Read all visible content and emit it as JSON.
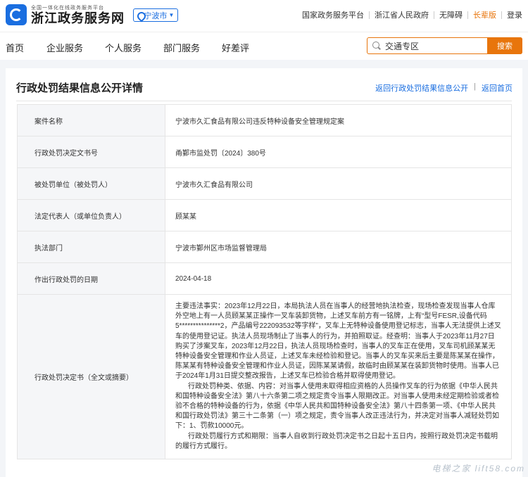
{
  "header": {
    "logo_sub": "全国一体化在线政务服务平台",
    "logo_main": "浙江政务服务网",
    "city": "宁波市",
    "links": [
      "国家政务服务平台",
      "浙江省人民政府",
      "无障碍",
      "长辈版",
      "登录"
    ]
  },
  "nav": {
    "items": [
      "首页",
      "企业服务",
      "个人服务",
      "部门服务",
      "好差评"
    ]
  },
  "search": {
    "value": "交通专区",
    "button": "搜索"
  },
  "page": {
    "title": "行政处罚结果信息公开详情",
    "link_back_list": "返回行政处罚结果信息公开",
    "link_sep": "|",
    "link_home": "返回首页"
  },
  "rows": [
    {
      "label": "案件名称",
      "value": "宁波市久汇食品有限公司违反特种设备安全管理规定案"
    },
    {
      "label": "行政处罚决定文书号",
      "value": "甬鄞市监处罚〔2024〕380号"
    },
    {
      "label": "被处罚单位（被处罚人）",
      "value": "宁波市久汇食品有限公司"
    },
    {
      "label": "法定代表人（或单位负责人）",
      "value": "顾某某"
    },
    {
      "label": "执法部门",
      "value": "宁波市鄞州区市场监督管理局"
    },
    {
      "label": "作出行政处罚的日期",
      "value": "2024-04-18"
    }
  ],
  "decision": {
    "label": "行政处罚决定书（全文或摘要）",
    "p1": "主要违法事实：2023年12月22日，本局执法人员在当事人的经营地执法检查，现场检查发现当事人仓库外空地上有一人员顾某某正操作一叉车装卸货物，上述叉车前方有一铭牌，上有“型号FESR,设备代码5***************2，产品编号222093532等字样”，叉车上无特种设备使用登记标志，当事人无法提供上述叉车的使用登记证。执法人员现场制止了当事人的行为，并拍照取证。经查明：当事人于2023年11月27日购买了涉案叉车，2023年12月22日，执法人员现场检查时，当事人的叉车正在使用，叉车司机顾某某无特种设备安全管理和作业人员证，上述叉车未经检验和登记。当事人的叉车买来后主要是陈某某在操作，陈某某有特种设备安全管理和作业人员证，因陈某某请假，故临时由顾某某在装卸货物时使用。当事人已于2024年1月31日提交整改报告，上述叉车已检验合格并取得使用登记。",
    "p2": "行政处罚种类、依据、内容：对当事人使用未取得相应资格的人员操作叉车的行为依据《中华人民共和国特种设备安全法》第八十六条第二项之规定责令当事人限期改正。对当事人使用未经定期检验或者检验不合格的特种设备的行为，依据《中华人民共和国特种设备安全法》第八十四条第一项、《中华人民共和国行政处罚法》第三十二条第（一）项之规定，责令当事人改正违法行为，并决定对当事人减轻处罚如下：1、罚款10000元。",
    "p3": "行政处罚履行方式和期限：当事人自收到行政处罚决定书之日起十五日内，按照行政处罚决定书载明的履行方式履行。"
  },
  "watermark": "电梯之家 lift58.com"
}
